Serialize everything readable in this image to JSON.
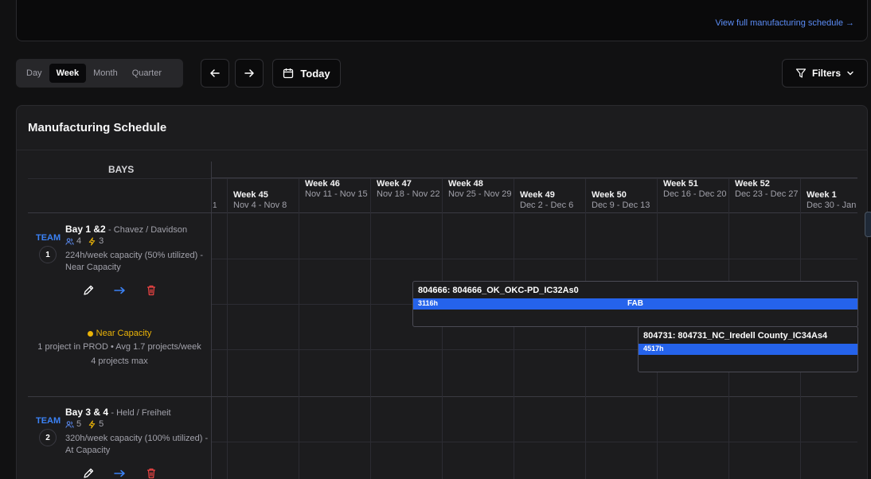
{
  "top_card": {
    "link_text": "View full manufacturing schedule →"
  },
  "view_toggle": {
    "options": [
      "Day",
      "Week",
      "Month",
      "Quarter"
    ],
    "selected": "Week"
  },
  "toolbar": {
    "today_label": "Today",
    "filters_label": "Filters"
  },
  "schedule": {
    "title": "Manufacturing Schedule",
    "bays_header": "BAYS",
    "week_one_partial": "1",
    "weeks": [
      {
        "name": "Week 45",
        "range": "Nov 4 - Nov 8"
      },
      {
        "name": "Week 46",
        "range": "Nov 11 - Nov 15"
      },
      {
        "name": "Week 47",
        "range": "Nov 18 - Nov 22"
      },
      {
        "name": "Week 48",
        "range": "Nov 25 - Nov 29"
      },
      {
        "name": "Week 49",
        "range": "Dec 2 - Dec 6"
      },
      {
        "name": "Week 50",
        "range": "Dec 9 - Dec 13"
      },
      {
        "name": "Week 51",
        "range": "Dec 16 - Dec 20"
      },
      {
        "name": "Week 52",
        "range": "Dec 23 - Dec 27"
      },
      {
        "name": "Week 1",
        "range": "Dec 30 - Jan"
      }
    ],
    "bays": [
      {
        "team": "TEAM",
        "number": "1",
        "name": "Bay 1 &2",
        "lead": "- Chavez / Davidson",
        "members": "4",
        "power": "3",
        "capacity": "224h/week capacity (50% utilized) - Near Capacity",
        "status": "Near Capacity",
        "status_line1": "1 project in PROD • Avg 1.7 projects/week",
        "status_line2": "4 projects max"
      },
      {
        "team": "TEAM",
        "number": "2",
        "name": "Bay 3 & 4",
        "lead": "- Held / Freiheit",
        "members": "5",
        "power": "5",
        "capacity": "320h/week capacity (100% utilized) - At Capacity"
      }
    ],
    "projects": [
      {
        "title": "804666: 804666_OK_OKC-PD_IC32As0",
        "hours": "3116h",
        "phase": "FAB"
      },
      {
        "title": "804731: 804731_NC_Iredell County_IC34As4",
        "hours": "4517h",
        "phase": ""
      }
    ]
  },
  "colors": {
    "accent": "#2563eb",
    "warning": "#eab308",
    "link": "#5b8cf5"
  }
}
